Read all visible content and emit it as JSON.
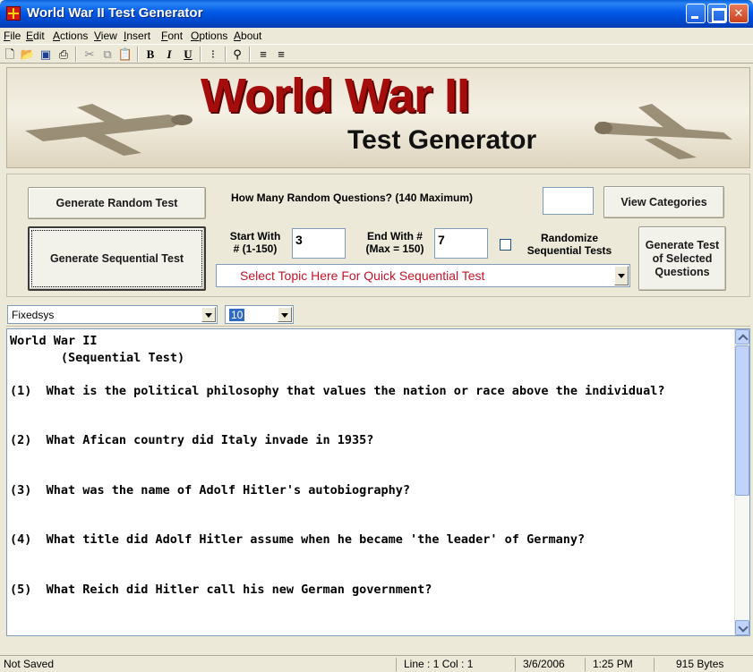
{
  "window": {
    "title": "World War II Test Generator"
  },
  "menu": [
    "File",
    "Edit",
    "Actions",
    "View",
    "Insert",
    "Font",
    "Options",
    "About"
  ],
  "banner": {
    "title": "World War II",
    "subtitle": "Test Generator"
  },
  "controls": {
    "generate_random": "Generate Random Test",
    "random_question_label": "How Many Random Questions? (140 Maximum)",
    "random_count_value": "",
    "view_categories": "View Categories",
    "generate_sequential": "Generate Sequential Test",
    "start_with_label": "Start With\n# (1-150)",
    "start_with_value": "3",
    "end_with_label": "End With #\n(Max = 150)",
    "end_with_value": "7",
    "randomize_label": "Randomize\nSequential Tests",
    "randomize_checked": false,
    "generate_selected": "Generate Test\nof Selected\nQuestions",
    "topic_select_text": "Select Topic Here For Quick Sequential Test"
  },
  "fontbar": {
    "font_name": "Fixedsys",
    "font_size": "10"
  },
  "editor": {
    "lines": [
      "World War II",
      "       (Sequential Test)",
      "",
      "(1)  What is the political philosophy that values the nation or race above the individual?",
      "",
      "",
      "(2)  What Afican country did Italy invade in 1935?",
      "",
      "",
      "(3)  What was the name of Adolf Hitler's autobiography?",
      "",
      "",
      "(4)  What title did Adolf Hitler assume when he became 'the leader' of Germany?",
      "",
      "",
      "(5)  What Reich did Hitler call his new German government?"
    ]
  },
  "status": {
    "save_state": "Not Saved",
    "position": "Line : 1   Col : 1",
    "date": "3/6/2006",
    "time": "1:25 PM",
    "size": "915 Bytes"
  },
  "colors": {
    "title_bar": "#0058E6",
    "banner_title": "#A50D0D",
    "topic_text": "#C4142A"
  }
}
